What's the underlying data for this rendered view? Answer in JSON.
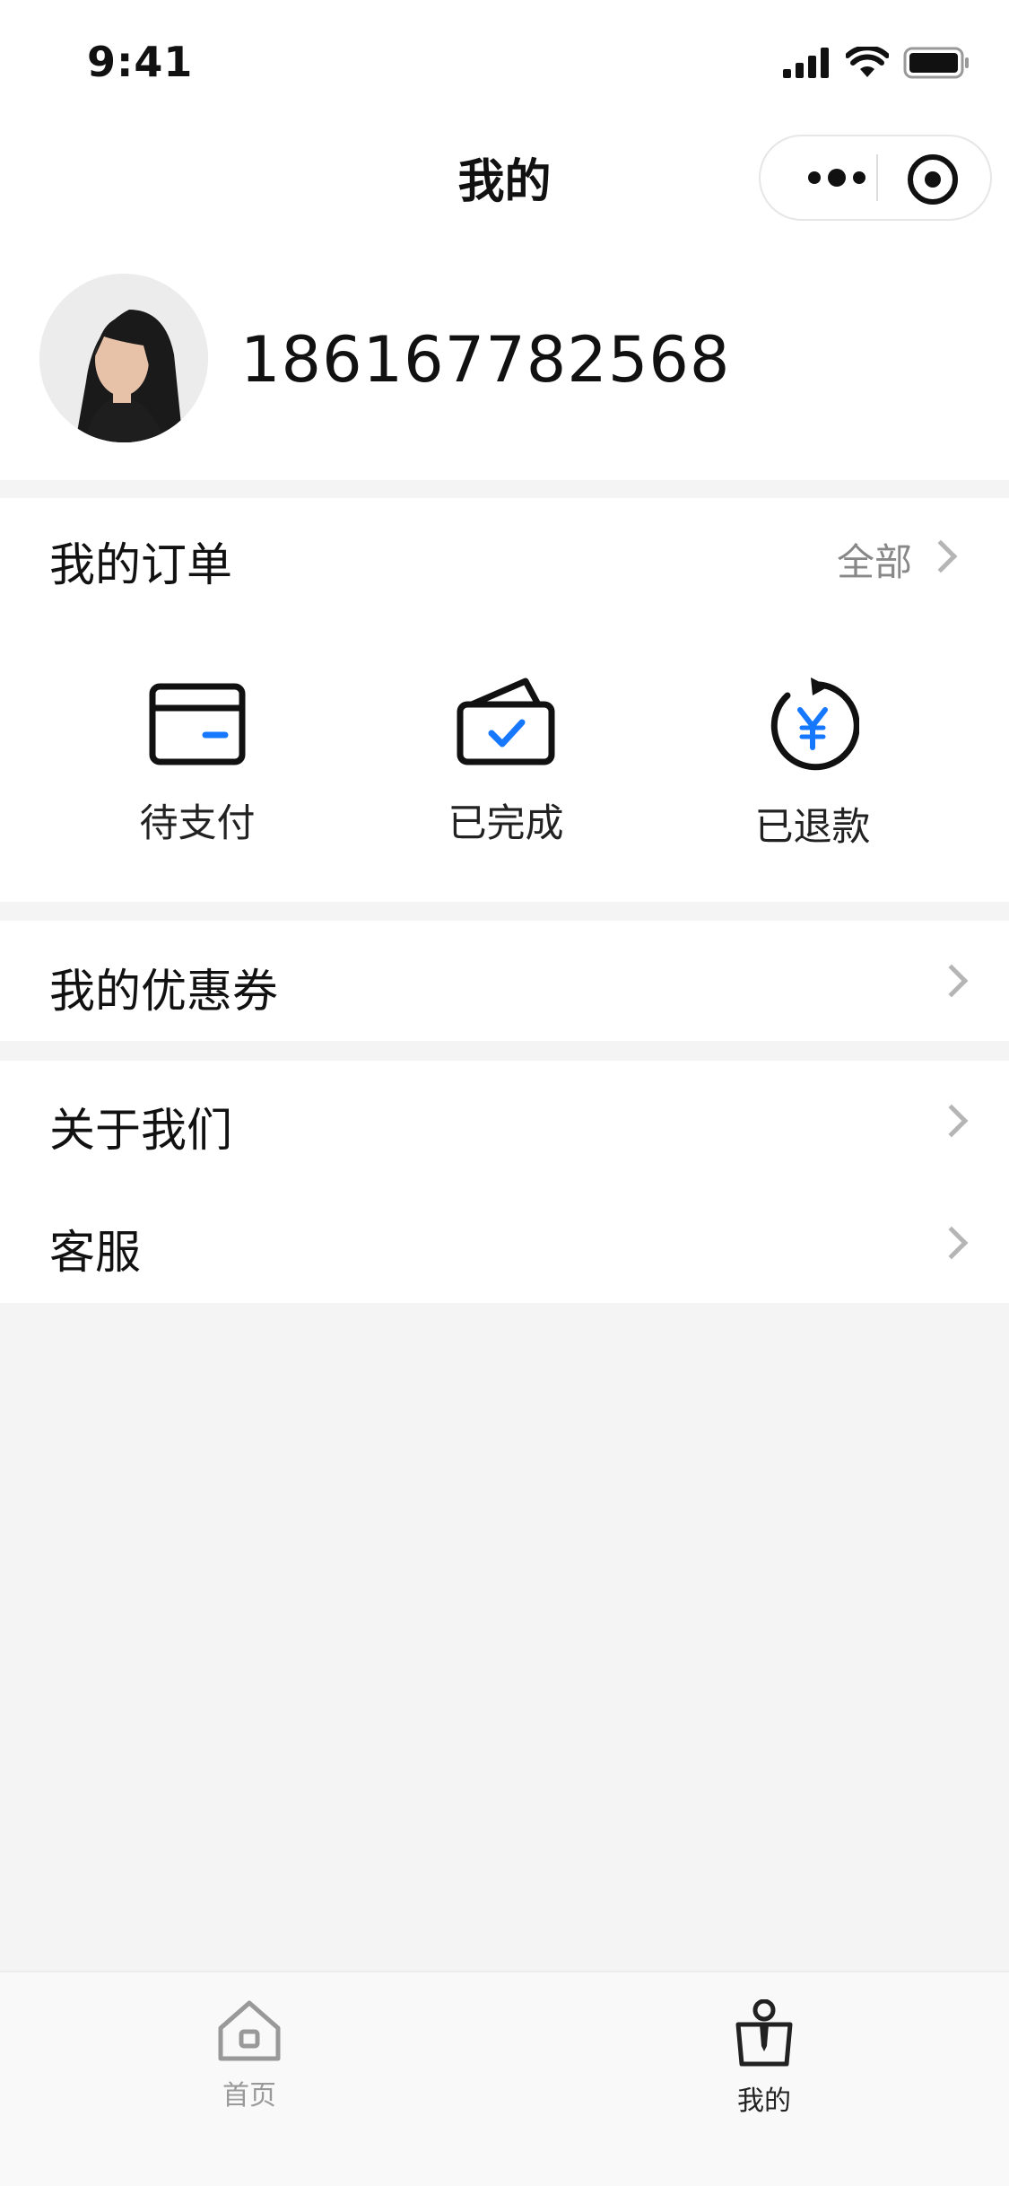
{
  "status_bar": {
    "time": "9:41"
  },
  "nav": {
    "title": "我的"
  },
  "profile": {
    "phone": "186167782568"
  },
  "orders": {
    "title": "我的订单",
    "all_label": "全部",
    "items": [
      {
        "label": "待支付",
        "icon": "card-icon"
      },
      {
        "label": "已完成",
        "icon": "wallet-check-icon"
      },
      {
        "label": "已退款",
        "icon": "refund-yuan-icon"
      }
    ]
  },
  "menu": {
    "coupons": "我的优惠券",
    "about": "关于我们",
    "service": "客服"
  },
  "tabbar": {
    "home": "首页",
    "mine": "我的"
  },
  "colors": {
    "accent": "#1677ff",
    "active_tab": "#222222",
    "inactive_tab": "#999999"
  }
}
